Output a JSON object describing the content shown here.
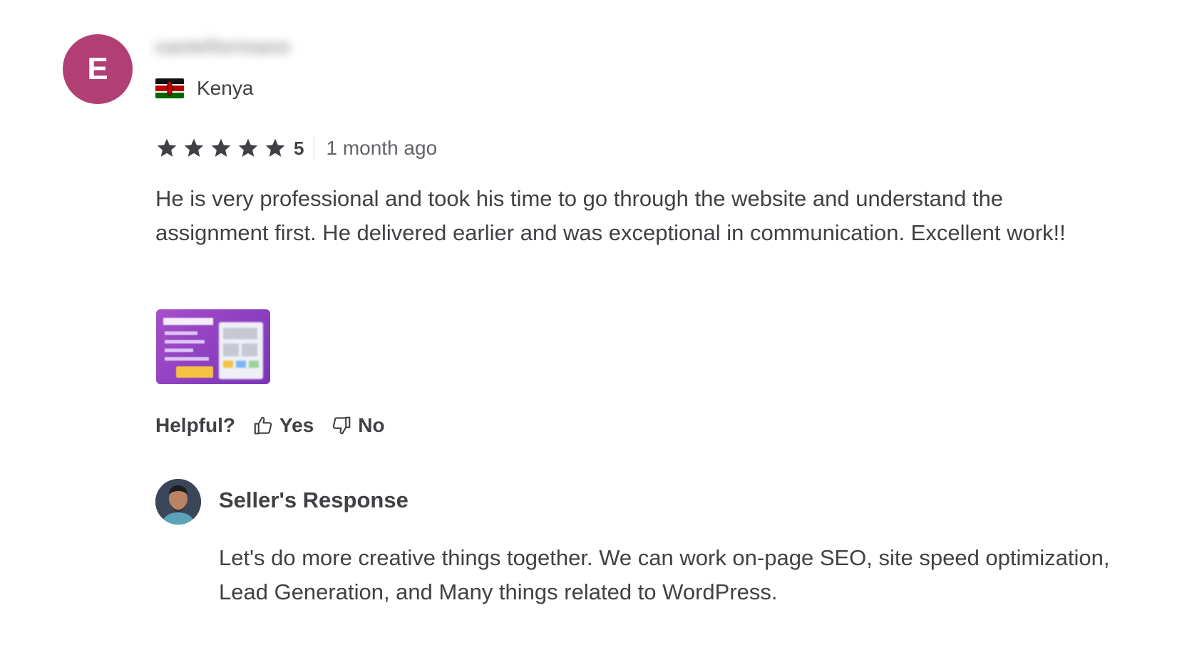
{
  "reviewer": {
    "avatar_letter": "E",
    "avatar_color": "#b13f74",
    "username": "castellorinaso",
    "country": "Kenya",
    "flag_icon": "kenya-flag-icon"
  },
  "rating": {
    "stars": 5,
    "value": "5",
    "star_color": "#404145",
    "date": "1 month ago"
  },
  "review": {
    "text": "He is very professional and took his time to go through the website and understand the assignment first. He delivered earlier and was exceptional in communication. Excellent work!!"
  },
  "attachment": {
    "type": "image-thumbnail",
    "accent_color": "#a64fc9"
  },
  "helpful": {
    "label": "Helpful?",
    "yes_label": "Yes",
    "no_label": "No",
    "yes_icon": "thumbs-up-icon",
    "no_icon": "thumbs-down-icon"
  },
  "seller_response": {
    "title": "Seller's Response",
    "text": "Let's do more creative things together. We can work on-page SEO, site speed optimization, Lead Generation, and Many things related to WordPress."
  }
}
